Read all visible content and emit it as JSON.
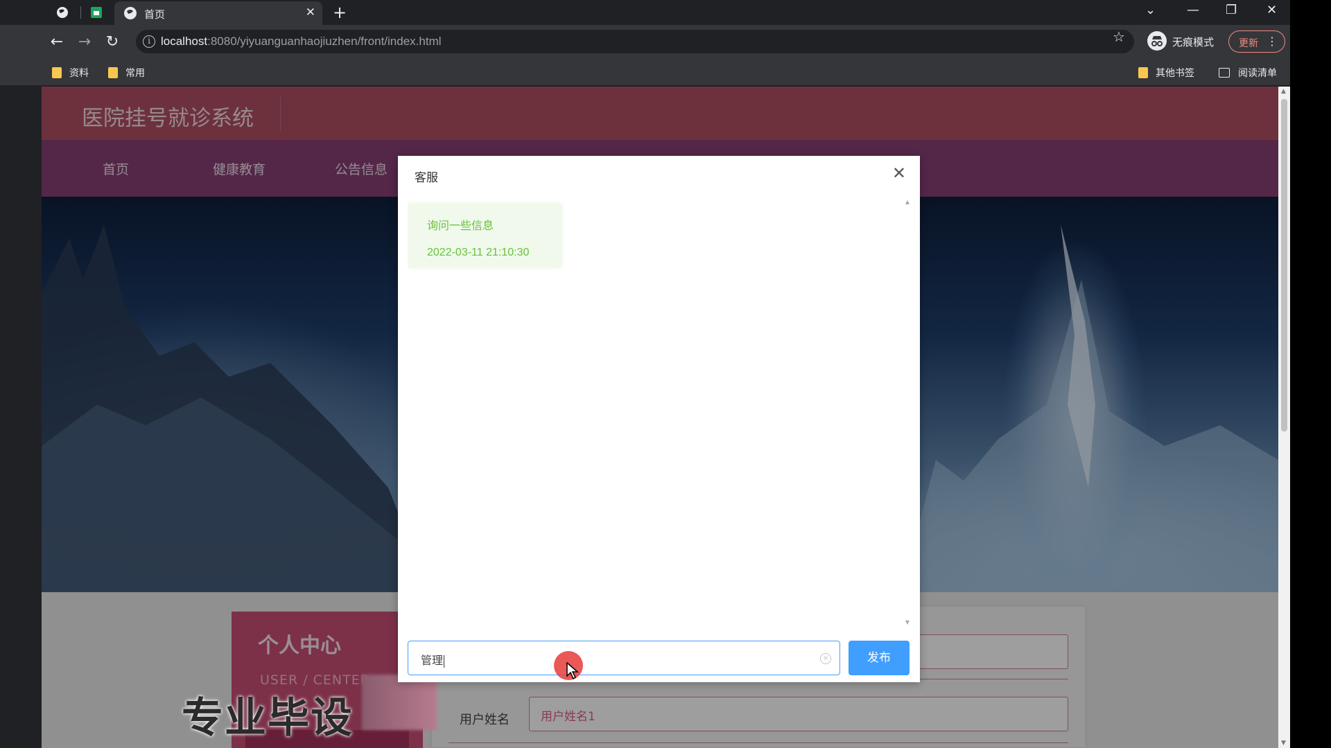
{
  "browser": {
    "tab_title": "首页",
    "url_host": "localhost",
    "url_rest": ":8080/yiyuanguanhaojiuzhen/front/index.html",
    "incognito_label": "无痕模式",
    "update_label": "更新",
    "bookmarks": [
      "资料",
      "常用"
    ],
    "bookmarks_right": [
      "其他书签",
      "阅读清单"
    ]
  },
  "site": {
    "title": "医院挂号就诊系统",
    "nav": [
      "首页",
      "健康教育",
      "公告信息"
    ]
  },
  "personal_center": {
    "title": "个人中心",
    "subtitle": "USER / CENTER",
    "username_label": "用户姓名",
    "username_value": "用户姓名1"
  },
  "watermark": "专业毕设",
  "dialog": {
    "title": "客服",
    "messages": [
      {
        "text": "询问一些信息",
        "time": "2022-03-11 21:10:30"
      }
    ],
    "input_value": "管理",
    "publish_label": "发布"
  },
  "colors": {
    "header": "#b05065",
    "nav": "#883f76",
    "primary": "#409eff",
    "bubble_text": "#67c23a",
    "bubble_bg": "#f0f9eb"
  }
}
